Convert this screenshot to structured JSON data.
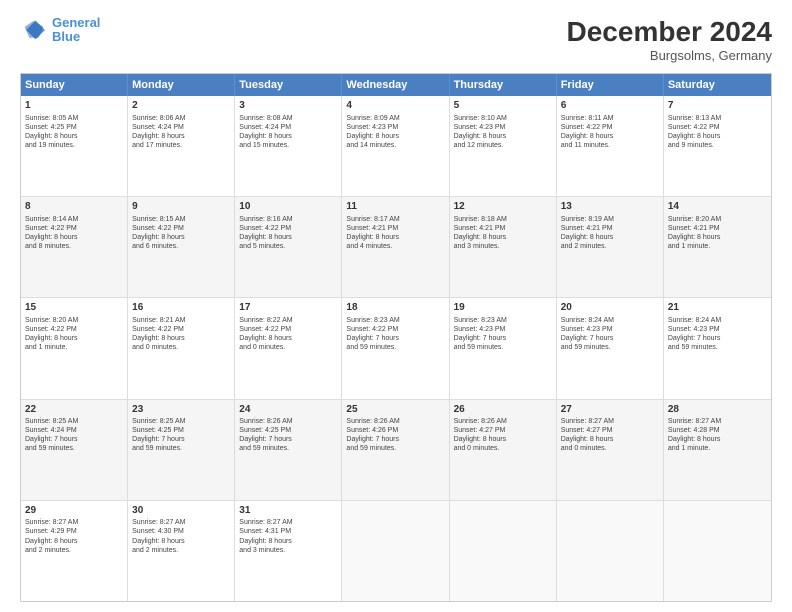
{
  "header": {
    "logo_line1": "General",
    "logo_line2": "Blue",
    "main_title": "December 2024",
    "subtitle": "Burgsolms, Germany"
  },
  "weekdays": [
    "Sunday",
    "Monday",
    "Tuesday",
    "Wednesday",
    "Thursday",
    "Friday",
    "Saturday"
  ],
  "rows": [
    [
      {
        "day": "1",
        "info": "Sunrise: 8:05 AM\nSunset: 4:25 PM\nDaylight: 8 hours\nand 19 minutes."
      },
      {
        "day": "2",
        "info": "Sunrise: 8:06 AM\nSunset: 4:24 PM\nDaylight: 8 hours\nand 17 minutes."
      },
      {
        "day": "3",
        "info": "Sunrise: 8:08 AM\nSunset: 4:24 PM\nDaylight: 8 hours\nand 15 minutes."
      },
      {
        "day": "4",
        "info": "Sunrise: 8:09 AM\nSunset: 4:23 PM\nDaylight: 8 hours\nand 14 minutes."
      },
      {
        "day": "5",
        "info": "Sunrise: 8:10 AM\nSunset: 4:23 PM\nDaylight: 8 hours\nand 12 minutes."
      },
      {
        "day": "6",
        "info": "Sunrise: 8:11 AM\nSunset: 4:22 PM\nDaylight: 8 hours\nand 11 minutes."
      },
      {
        "day": "7",
        "info": "Sunrise: 8:13 AM\nSunset: 4:22 PM\nDaylight: 8 hours\nand 9 minutes."
      }
    ],
    [
      {
        "day": "8",
        "info": "Sunrise: 8:14 AM\nSunset: 4:22 PM\nDaylight: 8 hours\nand 8 minutes."
      },
      {
        "day": "9",
        "info": "Sunrise: 8:15 AM\nSunset: 4:22 PM\nDaylight: 8 hours\nand 6 minutes."
      },
      {
        "day": "10",
        "info": "Sunrise: 8:16 AM\nSunset: 4:22 PM\nDaylight: 8 hours\nand 5 minutes."
      },
      {
        "day": "11",
        "info": "Sunrise: 8:17 AM\nSunset: 4:21 PM\nDaylight: 8 hours\nand 4 minutes."
      },
      {
        "day": "12",
        "info": "Sunrise: 8:18 AM\nSunset: 4:21 PM\nDaylight: 8 hours\nand 3 minutes."
      },
      {
        "day": "13",
        "info": "Sunrise: 8:19 AM\nSunset: 4:21 PM\nDaylight: 8 hours\nand 2 minutes."
      },
      {
        "day": "14",
        "info": "Sunrise: 8:20 AM\nSunset: 4:21 PM\nDaylight: 8 hours\nand 1 minute."
      }
    ],
    [
      {
        "day": "15",
        "info": "Sunrise: 8:20 AM\nSunset: 4:22 PM\nDaylight: 8 hours\nand 1 minute."
      },
      {
        "day": "16",
        "info": "Sunrise: 8:21 AM\nSunset: 4:22 PM\nDaylight: 8 hours\nand 0 minutes."
      },
      {
        "day": "17",
        "info": "Sunrise: 8:22 AM\nSunset: 4:22 PM\nDaylight: 8 hours\nand 0 minutes."
      },
      {
        "day": "18",
        "info": "Sunrise: 8:23 AM\nSunset: 4:22 PM\nDaylight: 7 hours\nand 59 minutes."
      },
      {
        "day": "19",
        "info": "Sunrise: 8:23 AM\nSunset: 4:23 PM\nDaylight: 7 hours\nand 59 minutes."
      },
      {
        "day": "20",
        "info": "Sunrise: 8:24 AM\nSunset: 4:23 PM\nDaylight: 7 hours\nand 59 minutes."
      },
      {
        "day": "21",
        "info": "Sunrise: 8:24 AM\nSunset: 4:23 PM\nDaylight: 7 hours\nand 59 minutes."
      }
    ],
    [
      {
        "day": "22",
        "info": "Sunrise: 8:25 AM\nSunset: 4:24 PM\nDaylight: 7 hours\nand 59 minutes."
      },
      {
        "day": "23",
        "info": "Sunrise: 8:25 AM\nSunset: 4:25 PM\nDaylight: 7 hours\nand 59 minutes."
      },
      {
        "day": "24",
        "info": "Sunrise: 8:26 AM\nSunset: 4:25 PM\nDaylight: 7 hours\nand 59 minutes."
      },
      {
        "day": "25",
        "info": "Sunrise: 8:26 AM\nSunset: 4:26 PM\nDaylight: 7 hours\nand 59 minutes."
      },
      {
        "day": "26",
        "info": "Sunrise: 8:26 AM\nSunset: 4:27 PM\nDaylight: 8 hours\nand 0 minutes."
      },
      {
        "day": "27",
        "info": "Sunrise: 8:27 AM\nSunset: 4:27 PM\nDaylight: 8 hours\nand 0 minutes."
      },
      {
        "day": "28",
        "info": "Sunrise: 8:27 AM\nSunset: 4:28 PM\nDaylight: 8 hours\nand 1 minute."
      }
    ],
    [
      {
        "day": "29",
        "info": "Sunrise: 8:27 AM\nSunset: 4:29 PM\nDaylight: 8 hours\nand 2 minutes."
      },
      {
        "day": "30",
        "info": "Sunrise: 8:27 AM\nSunset: 4:30 PM\nDaylight: 8 hours\nand 2 minutes."
      },
      {
        "day": "31",
        "info": "Sunrise: 8:27 AM\nSunset: 4:31 PM\nDaylight: 8 hours\nand 3 minutes."
      },
      {
        "day": "",
        "info": ""
      },
      {
        "day": "",
        "info": ""
      },
      {
        "day": "",
        "info": ""
      },
      {
        "day": "",
        "info": ""
      }
    ]
  ]
}
